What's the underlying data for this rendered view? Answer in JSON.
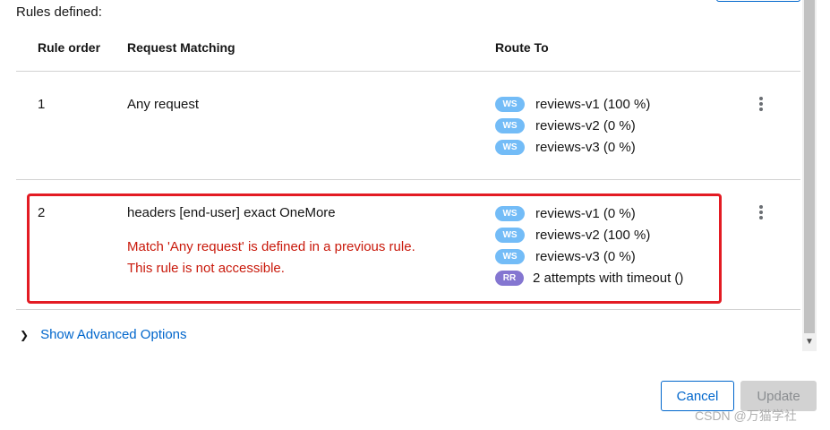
{
  "heading": "Rules defined:",
  "columns": {
    "rule_order": "Rule order",
    "request_matching": "Request Matching",
    "route_to": "Route To"
  },
  "rules": [
    {
      "order": "1",
      "matching": "Any request",
      "routes": [
        {
          "badge": "WS",
          "text": "reviews-v1 (100 %)"
        },
        {
          "badge": "WS",
          "text": "reviews-v2 (0 %)"
        },
        {
          "badge": "WS",
          "text": "reviews-v3 (0 %)"
        }
      ]
    },
    {
      "order": "2",
      "matching": "headers [end-user] exact OneMore",
      "warning_line1": "Match 'Any request' is defined in a previous rule.",
      "warning_line2": "This rule is not accessible.",
      "routes": [
        {
          "badge": "WS",
          "text": "reviews-v1 (0 %)"
        },
        {
          "badge": "WS",
          "text": "reviews-v2 (100 %)"
        },
        {
          "badge": "WS",
          "text": "reviews-v3 (0 %)"
        },
        {
          "badge": "RR",
          "text": "2 attempts with timeout ()"
        }
      ]
    }
  ],
  "advanced_options": "Show Advanced Options",
  "buttons": {
    "cancel": "Cancel",
    "update": "Update"
  },
  "watermark": "CSDN @万猫学社",
  "colors": {
    "link": "#0066cc",
    "error": "#c9190b",
    "ws_badge": "#73bcf7",
    "rr_badge": "#8476d1",
    "highlight": "#e31b23"
  }
}
